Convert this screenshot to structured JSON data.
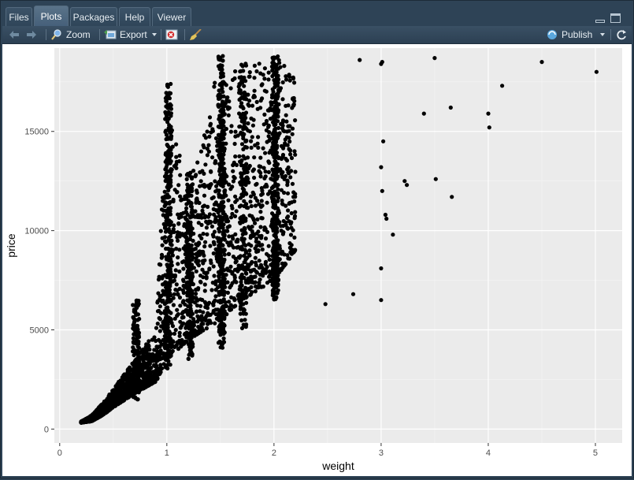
{
  "tabs": [
    {
      "label": "Files"
    },
    {
      "label": "Plots"
    },
    {
      "label": "Packages"
    },
    {
      "label": "Help"
    },
    {
      "label": "Viewer"
    }
  ],
  "active_tab": "Plots",
  "toolbar": {
    "zoom_label": "Zoom",
    "export_label": "Export",
    "publish_label": "Publish"
  },
  "icons": [
    "back-arrow-icon",
    "forward-arrow-icon",
    "zoom-icon",
    "export-icon",
    "remove-plot-icon",
    "clear-broom-icon",
    "publish-icon",
    "refresh-icon",
    "minimize-icon",
    "maximize-icon"
  ],
  "colors": {
    "panel_bg": "#ebebeb",
    "grid": "#ffffff",
    "points": "#000000",
    "chrome": "#2e4356"
  },
  "chart_data": {
    "type": "scatter",
    "xlabel": "weight",
    "ylabel": "price",
    "xlim": [
      -0.05,
      5.25
    ],
    "ylim": [
      -700,
      19200
    ],
    "x_ticks": [
      0,
      1,
      2,
      3,
      4,
      5
    ],
    "y_ticks": [
      0,
      5000,
      10000,
      15000
    ],
    "x_tick_labels": [
      "0",
      "1",
      "2",
      "3",
      "4",
      "5"
    ],
    "y_tick_labels": [
      "0",
      "5000",
      "10000",
      "15000"
    ],
    "grid": true,
    "dense_region": [
      [
        0.2,
        326,
        380
      ],
      [
        0.3,
        400,
        700
      ],
      [
        0.4,
        700,
        1300
      ],
      [
        0.5,
        1100,
        2000
      ],
      [
        0.7,
        1800,
        3500
      ],
      [
        0.9,
        2400,
        5000
      ],
      [
        1.0,
        3500,
        16500
      ],
      [
        1.2,
        4500,
        12000
      ],
      [
        1.5,
        5500,
        18800
      ],
      [
        1.7,
        6500,
        18000
      ],
      [
        2.0,
        7500,
        18800
      ],
      [
        2.2,
        9000,
        18000
      ]
    ],
    "points": [
      [
        2.8,
        18600
      ],
      [
        3.0,
        18400
      ],
      [
        3.01,
        18500
      ],
      [
        3.5,
        18700
      ],
      [
        4.5,
        18500
      ],
      [
        5.01,
        18000
      ],
      [
        4.13,
        17300
      ],
      [
        3.4,
        15900
      ],
      [
        3.65,
        16200
      ],
      [
        4.0,
        15900
      ],
      [
        4.01,
        15200
      ],
      [
        3.22,
        12500
      ],
      [
        3.24,
        12300
      ],
      [
        3.51,
        12600
      ],
      [
        3.66,
        11700
      ],
      [
        3.04,
        10800
      ],
      [
        3.11,
        9800
      ],
      [
        3.0,
        8100
      ],
      [
        3.0,
        6500
      ],
      [
        2.74,
        6800
      ],
      [
        2.48,
        6300
      ],
      [
        3.02,
        14500
      ],
      [
        3.0,
        13200
      ],
      [
        3.01,
        12000
      ],
      [
        3.05,
        10600
      ]
    ]
  }
}
